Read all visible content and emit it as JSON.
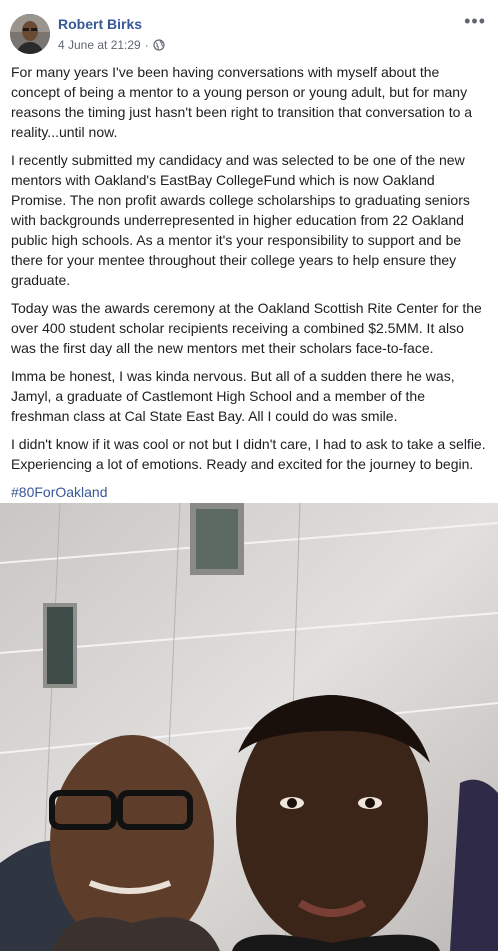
{
  "post": {
    "author": "Robert Birks",
    "date": "4 June at 21:29",
    "separator": "·",
    "privacy_icon": "globe-icon",
    "more_icon": "ellipsis-icon",
    "paragraphs": [
      "For many years I've been having conversations with myself about the concept of being a mentor to a young person or young adult, but for many reasons the timing just hasn't been right to transition that conversation to a reality...until now.",
      "I recently submitted my candidacy and was selected to be one of the new mentors with Oakland's EastBay CollegeFund which is now Oakland Promise. The non profit awards college scholarships to graduating seniors with backgrounds underrepresented in higher education from 22 Oakland public high schools. As a mentor it's your responsibility to support and be there for your mentee throughout their college years to help ensure they graduate.",
      "Today was the awards ceremony at the Oakland Scottish Rite Center for the over 400 student scholar recipients receiving a combined $2.5MM. It also was the first day all the new mentors met their scholars face-to-face.",
      "Imma be honest, I was kinda nervous. But all of a sudden there he was, Jamyl, a graduate of Castlemont High School and a member of the freshman class at Cal State East Bay. All I could do was smile.",
      "I didn't know if it was cool or not but I didn't care, I had to ask to take a selfie. Experiencing a lot of emotions. Ready and excited for the journey to begin."
    ],
    "hashtag": "#80ForOakland"
  },
  "colors": {
    "link": "#385898",
    "text": "#1c1e21",
    "meta": "#606770"
  }
}
